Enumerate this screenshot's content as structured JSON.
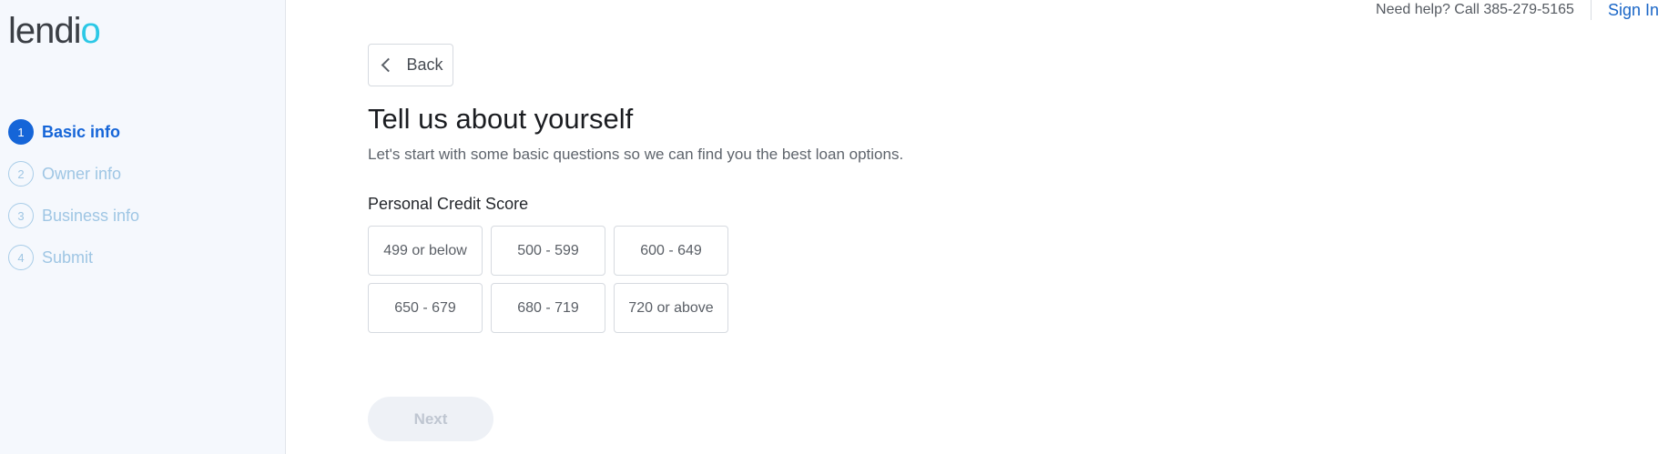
{
  "brand": {
    "name_prefix": "lendi",
    "name_suffix": "o"
  },
  "sidebar": {
    "steps": [
      {
        "number": "1",
        "label": "Basic info",
        "state": "active"
      },
      {
        "number": "2",
        "label": "Owner info",
        "state": "inactive"
      },
      {
        "number": "3",
        "label": "Business info",
        "state": "inactive"
      },
      {
        "number": "4",
        "label": "Submit",
        "state": "inactive"
      }
    ]
  },
  "header": {
    "help_text": "Need help? Call 385-279-5165",
    "signin_label": "Sign In"
  },
  "main": {
    "back_label": "Back",
    "title": "Tell us about yourself",
    "subtitle": "Let's start with some basic questions so we can find you the best loan options.",
    "question_label": "Personal Credit Score",
    "options": [
      "499 or below",
      "500 - 599",
      "600 - 649",
      "650 - 679",
      "680 - 719",
      "720 or above"
    ],
    "next_label": "Next"
  },
  "colors": {
    "accent": "#1565d8",
    "logo_accent": "#2cc8e6",
    "sidebar_bg": "#f5f8fd",
    "inactive_step": "#9fc6e4",
    "disabled_button_bg": "#eef1f6"
  },
  "icons": {
    "back": "chevron-left-icon"
  }
}
